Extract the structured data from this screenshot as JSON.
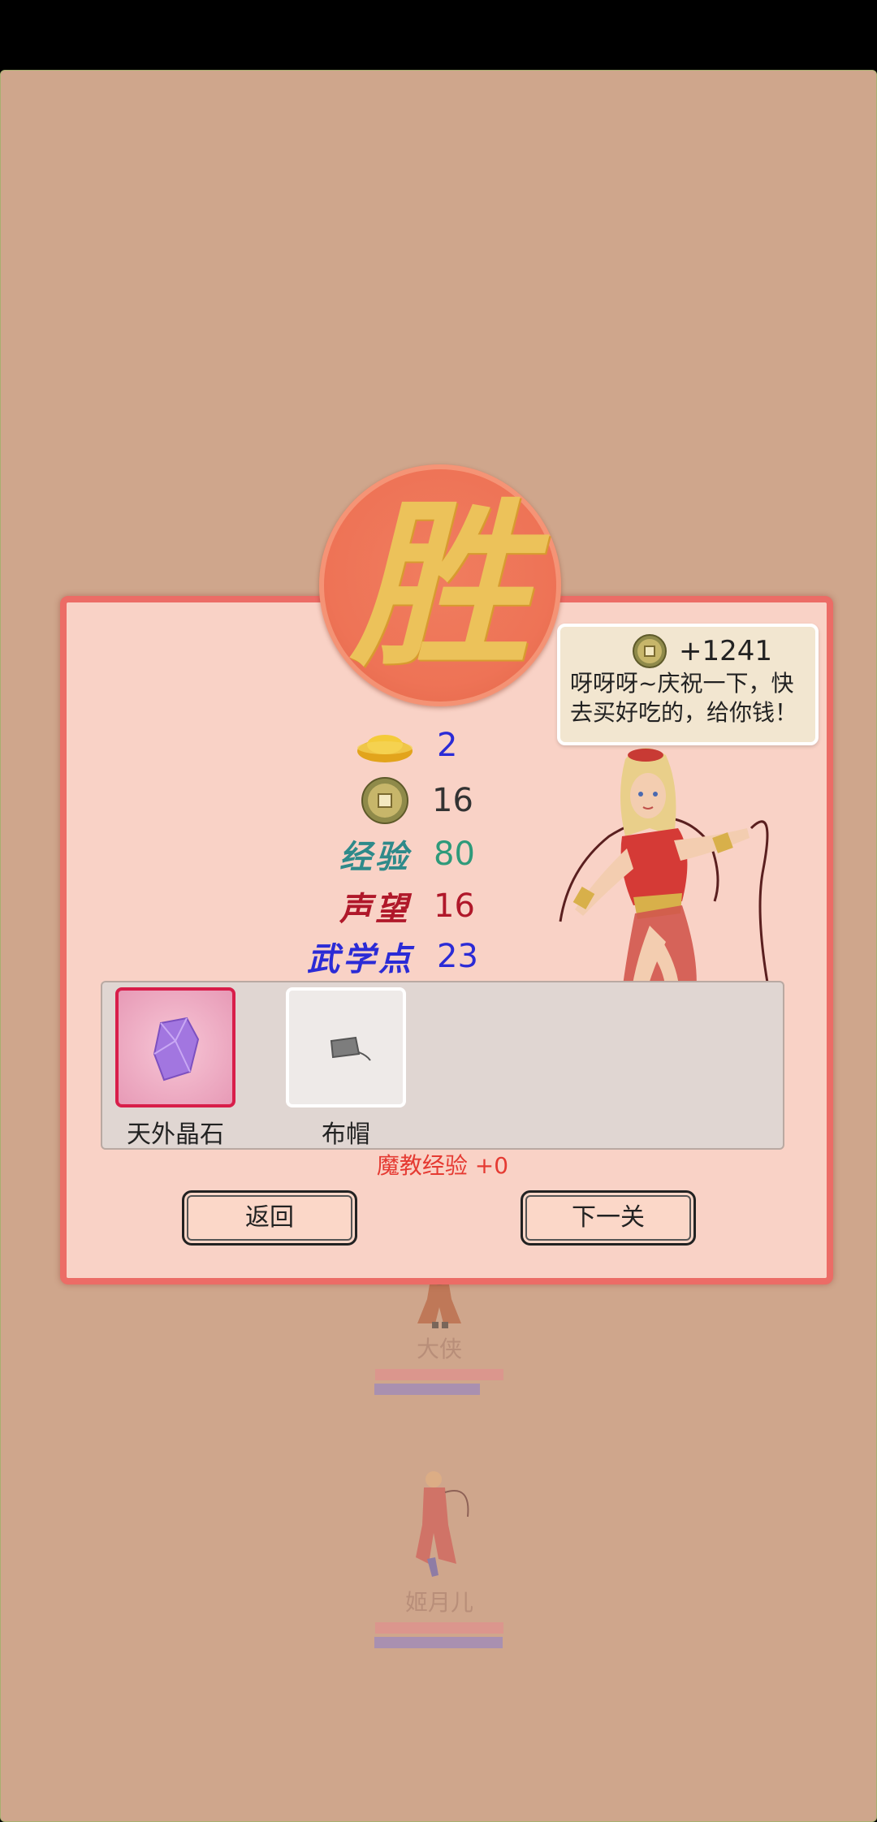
{
  "result": {
    "badge": "胜"
  },
  "rewards": {
    "ingot": "2",
    "coins": "16",
    "exp_label": "经验",
    "exp": "80",
    "fame_label": "声望",
    "fame": "16",
    "martial_label": "武学点",
    "martial": "23"
  },
  "items": [
    {
      "name": "天外晶石",
      "icon": "purple-crystal-icon"
    },
    {
      "name": "布帽",
      "icon": "cloth-hat-icon"
    }
  ],
  "demon_exp": "魔教经验 +0",
  "buttons": {
    "back": "返回",
    "next": "下一关"
  },
  "speech": {
    "gold_gain": "+1241",
    "message": "呀呀呀~庆祝一下，快去买好吃的，给你钱！"
  },
  "units": [
    {
      "name": "大侠"
    },
    {
      "name": "姬月儿"
    }
  ],
  "colors": {
    "background": "#cfa68c",
    "dialog": "#f9d2c6",
    "dialog_border": "#ec6c66",
    "ingot_value": "#2b2bd6",
    "exp_value": "#2e9a7a",
    "fame_value": "#b0182a",
    "martial_value": "#2b2bd6",
    "demon_exp": "#e53a32"
  }
}
